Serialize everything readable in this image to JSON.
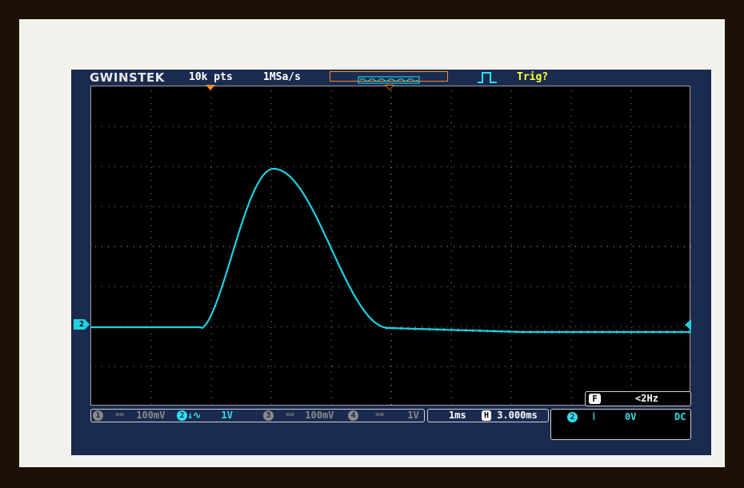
{
  "header": {
    "brand": "GWINSTEK",
    "record_length": "10k pts",
    "sample_rate": "1MSa/s",
    "trigger_status": "Trig?"
  },
  "channels": [
    {
      "id": "1",
      "coupling": "==",
      "scale": "100mV",
      "active": false
    },
    {
      "id": "2",
      "coupling": "↓∿",
      "scale": "1V",
      "active": true
    },
    {
      "id": "3",
      "coupling": "==",
      "scale": "100mV",
      "active": false
    },
    {
      "id": "4",
      "coupling": "==",
      "scale": "1V",
      "active": false
    }
  ],
  "ground_marker": "2",
  "timebase": {
    "scale": "1ms",
    "h_badge": "H",
    "position": "3.000ms"
  },
  "frequency": {
    "badge": "F",
    "value": "<2Hz"
  },
  "trigger": {
    "source": "2",
    "slope": "⦚",
    "level": "0V",
    "coupling": "DC"
  },
  "colors": {
    "channel2": "#1fd0e0",
    "memory_bar": "#ff8c1a",
    "trigger_text": "#ffff33",
    "screen_bg": "#1a2b4f"
  },
  "icons": {
    "trigger_pulse": "rising-pulse-icon",
    "memory": "waveform-memory-bar",
    "ground": "ch2-ground-marker"
  }
}
